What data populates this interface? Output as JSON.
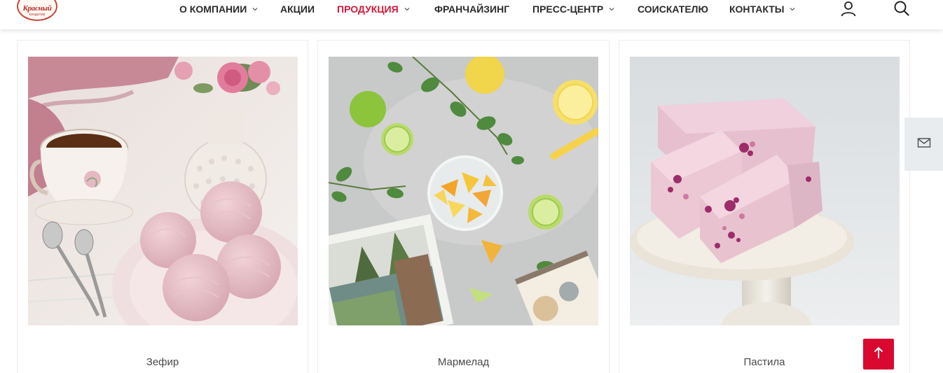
{
  "logo": {
    "main": "Красный",
    "sub": "кондитер"
  },
  "nav": {
    "items": [
      {
        "label": "О КОМПАНИИ",
        "dropdown": true,
        "active": false
      },
      {
        "label": "АКЦИИ",
        "dropdown": false,
        "active": false
      },
      {
        "label": "ПРОДУКЦИЯ",
        "dropdown": true,
        "active": true
      },
      {
        "label": "ФРАНЧАЙЗИНГ",
        "dropdown": false,
        "active": false
      },
      {
        "label": "ПРЕСС-ЦЕНТР",
        "dropdown": true,
        "active": false
      },
      {
        "label": "СОИСКАТЕЛЮ",
        "dropdown": false,
        "active": false
      },
      {
        "label": "КОНТАКТЫ",
        "dropdown": true,
        "active": false
      }
    ],
    "icons": [
      "user-icon",
      "search-icon"
    ]
  },
  "products": [
    {
      "name": "Зефир",
      "image": "zephyr-photo"
    },
    {
      "name": "Мармелад",
      "image": "marmalade-photo"
    },
    {
      "name": "Пастила",
      "image": "pastila-photo"
    }
  ],
  "side_tab": {
    "icon": "mail-icon"
  },
  "scroll_top": {
    "icon": "arrow-up-icon"
  },
  "colors": {
    "accent": "#d2173b",
    "button": "#d9082f",
    "nav_text": "#2b2b2b"
  }
}
